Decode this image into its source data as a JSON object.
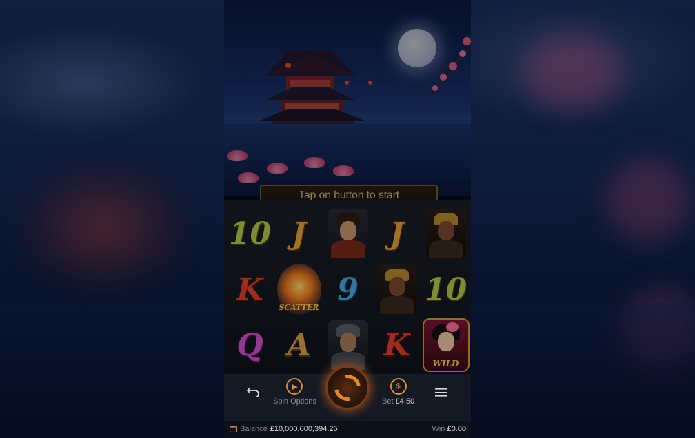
{
  "banner": {
    "text": "Tap on button to start"
  },
  "reels": {
    "rows": [
      [
        "10",
        "J",
        "warrior-hero",
        "J",
        "general-bearded"
      ],
      [
        "K",
        "scatter",
        "9",
        "general-bearded",
        "10"
      ],
      [
        "Q",
        "A",
        "soldiers",
        "K",
        "wild"
      ]
    ],
    "scatter_label": "SCATTER",
    "wild_label": "WILD"
  },
  "controls": {
    "back_icon": "back-arrow-icon",
    "spin_options_label": "Spin Options",
    "bet_label": "Bet",
    "bet_value": "£4.50",
    "bet_icon_glyph": "$",
    "menu_icon": "hamburger-menu-icon"
  },
  "status": {
    "balance_label": "Balance",
    "balance_value": "£10,000,000,394.25",
    "win_label": "Win",
    "win_value": "£0.00"
  },
  "colors": {
    "accent": "#d88d33",
    "panel": "#141923"
  }
}
